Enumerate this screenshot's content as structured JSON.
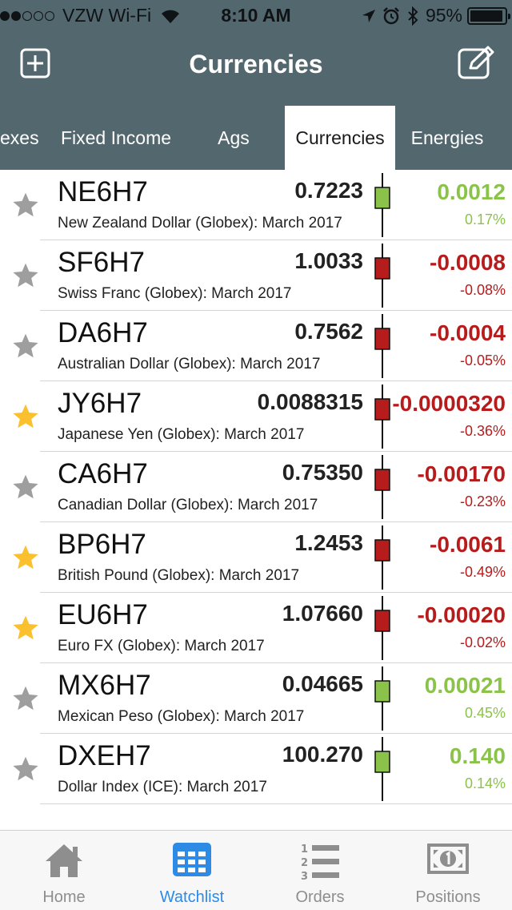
{
  "status_bar": {
    "carrier": "VZW Wi-Fi",
    "time": "8:10 AM",
    "battery": "95%",
    "battery_level": 0.95,
    "signal_bars": 2
  },
  "header": {
    "title": "Currencies",
    "add_icon": "plus-square-icon",
    "edit_icon": "edit-icon"
  },
  "tabs": [
    {
      "label": "exes"
    },
    {
      "label": "Fixed Income"
    },
    {
      "label": "Ags"
    },
    {
      "label": "Currencies"
    },
    {
      "label": "Energies"
    }
  ],
  "active_tab": "Currencies",
  "colors": {
    "header_bg": "#53676f",
    "up": "#8bc34a",
    "down": "#b71c1c",
    "star_on": "#fbc02d",
    "star_off": "#9e9e9e",
    "accent": "#2d8be6"
  },
  "rows": [
    {
      "symbol": "NE6H7",
      "description": "New Zealand Dollar (Globex): March 2017",
      "price": "0.7223",
      "change": "0.0012",
      "percent": "0.17%",
      "direction": "up",
      "starred": false
    },
    {
      "symbol": "SF6H7",
      "description": "Swiss Franc (Globex): March 2017",
      "price": "1.0033",
      "change": "-0.0008",
      "percent": "-0.08%",
      "direction": "down",
      "starred": false
    },
    {
      "symbol": "DA6H7",
      "description": "Australian Dollar (Globex): March 2017",
      "price": "0.7562",
      "change": "-0.0004",
      "percent": "-0.05%",
      "direction": "down",
      "starred": false
    },
    {
      "symbol": "JY6H7",
      "description": "Japanese Yen (Globex): March 2017",
      "price": "0.0088315",
      "change": "-0.0000320",
      "percent": "-0.36%",
      "direction": "down",
      "starred": true
    },
    {
      "symbol": "CA6H7",
      "description": "Canadian Dollar (Globex): March 2017",
      "price": "0.75350",
      "change": "-0.00170",
      "percent": "-0.23%",
      "direction": "down",
      "starred": false
    },
    {
      "symbol": "BP6H7",
      "description": "British Pound (Globex): March 2017",
      "price": "1.2453",
      "change": "-0.0061",
      "percent": "-0.49%",
      "direction": "down",
      "starred": true
    },
    {
      "symbol": "EU6H7",
      "description": "Euro FX (Globex): March 2017",
      "price": "1.07660",
      "change": "-0.00020",
      "percent": "-0.02%",
      "direction": "down",
      "starred": true
    },
    {
      "symbol": "MX6H7",
      "description": "Mexican Peso (Globex): March 2017",
      "price": "0.04665",
      "change": "0.00021",
      "percent": "0.45%",
      "direction": "up",
      "starred": false
    },
    {
      "symbol": "DXEH7",
      "description": "Dollar Index (ICE): March 2017",
      "price": "100.270",
      "change": "0.140",
      "percent": "0.14%",
      "direction": "up",
      "starred": false
    }
  ],
  "bottom_nav": [
    {
      "label": "Home",
      "icon": "home-icon",
      "active": false
    },
    {
      "label": "Watchlist",
      "icon": "grid-icon",
      "active": true
    },
    {
      "label": "Orders",
      "icon": "numbered-list-icon",
      "active": false
    },
    {
      "label": "Positions",
      "icon": "cash-icon",
      "active": false
    }
  ]
}
